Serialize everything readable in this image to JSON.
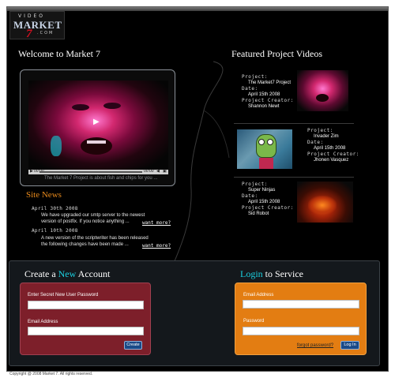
{
  "logo": {
    "line1": "VIDEO",
    "line2": "MARKET",
    "line3": "7",
    "line4": ".COM"
  },
  "welcome": {
    "title": "Welcome to Market 7",
    "player": {
      "time_elapsed": "00:00",
      "time_total": "00:00",
      "caption": "The Market 7 Project is about fish and chips for you ..."
    }
  },
  "news": {
    "title": "Site News",
    "items": [
      {
        "date": "April 30th 2008",
        "text_line1": "We have upgraded our smtp server to the newest",
        "text_line2": "version of postfix. If you notice anything ...",
        "more": "want more?"
      },
      {
        "date": "April 10th 2008",
        "text_line1": "A new version of the scriptwriter has been released",
        "text_line2": "the following changes have been made ...",
        "more": "want more?"
      }
    ]
  },
  "featured": {
    "title": "Featured Project Videos",
    "labels": {
      "project": "Project:",
      "date": "Date:",
      "creator": "Project Creator:"
    },
    "items": [
      {
        "project": "The Market7 Project",
        "date": "April 15th 2008",
        "creator": "Shannon Newt"
      },
      {
        "project": "Invader Zim",
        "date": "April 15th 2008",
        "creator": "Jhonen Vasquez"
      },
      {
        "project": "Super Ninjas",
        "date": "April 15th 2008",
        "creator": "Sid Robot"
      }
    ]
  },
  "create_account": {
    "title_pre": "Create a ",
    "title_highlight": "New",
    "title_post": " Account",
    "password_label": "Enter Secret New User Password",
    "password_value": "",
    "email_label": "Email Address",
    "email_value": "",
    "button": "Create"
  },
  "login": {
    "title_highlight": "Login",
    "title_post": " to Service",
    "email_label": "Email Address",
    "email_value": "",
    "password_label": "Password",
    "password_value": "",
    "forgot": "forgot password?",
    "button": "Log In"
  },
  "footer": "Copyright @ 2008 Market 7. All rights reserved.",
  "colors": {
    "page_bg": "#000000",
    "news_title": "#e88a1c",
    "highlight": "#1ad0e0",
    "create_panel": "#7d1f2a",
    "login_panel": "#e37d12",
    "button": "#1a4a88"
  }
}
